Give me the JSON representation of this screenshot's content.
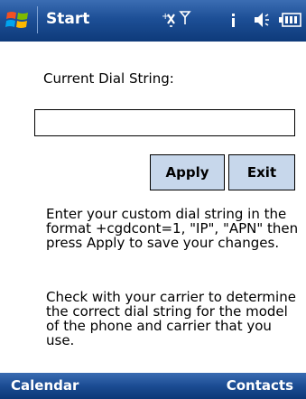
{
  "titlebar": {
    "title": "Start",
    "start_icon": "windows-flag-icon",
    "indicators": [
      "connectivity-icon",
      "notification-icon",
      "volume-icon",
      "battery-icon"
    ]
  },
  "form": {
    "dial_label": "Current Dial String:",
    "dial_value": "",
    "apply_label": "Apply",
    "exit_label": "Exit"
  },
  "help": {
    "paragraph1": "Enter your custom dial string in the format +cgdcont=1, \"IP\", \"APN\" then press Apply to save your changes.",
    "paragraph2": "Check with your carrier to determine the correct dial string for the model of the phone and carrier that you use."
  },
  "softkeys": {
    "left": "Calendar",
    "right": "Contacts"
  },
  "colors": {
    "titlebar": "#1d4f96",
    "button_bg": "#c7d7eb",
    "softbar": "#1b4c93"
  }
}
